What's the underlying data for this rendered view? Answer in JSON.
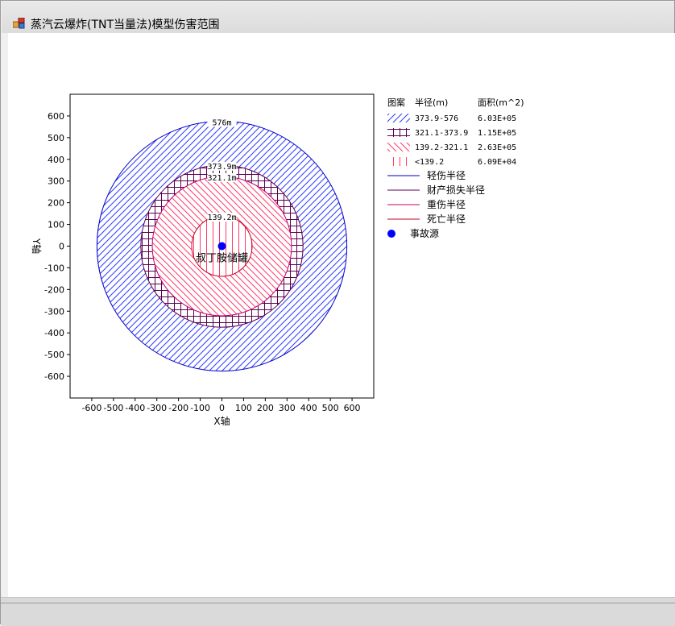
{
  "window": {
    "title": "蒸汽云爆炸(TNT当量法)模型伤害范围",
    "icon": "app-window-icon"
  },
  "chart_data": {
    "type": "area",
    "title": "",
    "xlabel": "X轴",
    "ylabel": "Y轴",
    "xlim": [
      -700,
      700
    ],
    "ylim": [
      -700,
      700
    ],
    "xticks": [
      -600,
      -500,
      -400,
      -300,
      -200,
      -100,
      0,
      100,
      200,
      300,
      400,
      500,
      600
    ],
    "yticks": [
      600,
      500,
      400,
      300,
      200,
      100,
      0,
      -100,
      -200,
      -300,
      -400,
      -500,
      -600
    ],
    "grid": false,
    "center": [
      0,
      0
    ],
    "source_label": "叔丁胺储罐",
    "source_color": "#0000ff",
    "rings": [
      {
        "radius": 576,
        "label": "576m",
        "color": "#0000c8",
        "hatch": "diagonal-up",
        "hatch_color": "#2f3cff"
      },
      {
        "radius": 373.9,
        "label": "373.9m",
        "color": "#5a0050",
        "hatch": "cross",
        "hatch_color": "#5a0050"
      },
      {
        "radius": 321.1,
        "label": "321.1m",
        "color": "#c0006e",
        "hatch": "diagonal-down",
        "hatch_color": "#ff3a6a"
      },
      {
        "radius": 139.2,
        "label": "139.2m",
        "color": "#c00020",
        "hatch": "vertical",
        "hatch_color": "#ff3a6a"
      }
    ],
    "legend": {
      "placement": "right",
      "headers": [
        "图案",
        "半径(m)",
        "面积(m^2)"
      ],
      "rows": [
        {
          "hatch": "diagonal-up",
          "color": "#2f3cff",
          "radius": "373.9-576",
          "area": "6.03E+05"
        },
        {
          "hatch": "cross",
          "color": "#5a0050",
          "radius": "321.1-373.9",
          "area": "1.15E+05"
        },
        {
          "hatch": "diagonal-down",
          "color": "#ff3a6a",
          "radius": "139.2-321.1",
          "area": "2.63E+05"
        },
        {
          "hatch": "vertical",
          "color": "#ff3a6a",
          "radius": "<139.2",
          "area": "6.09E+04"
        }
      ],
      "lines": [
        {
          "label": "轻伤半径",
          "color": "#0000c8"
        },
        {
          "label": "财产损失半径",
          "color": "#5a0050"
        },
        {
          "label": "重伤半径",
          "color": "#c0006e"
        },
        {
          "label": "死亡半径",
          "color": "#c00020"
        }
      ],
      "marker": {
        "label": "事故源",
        "color": "#0000ff"
      }
    }
  }
}
